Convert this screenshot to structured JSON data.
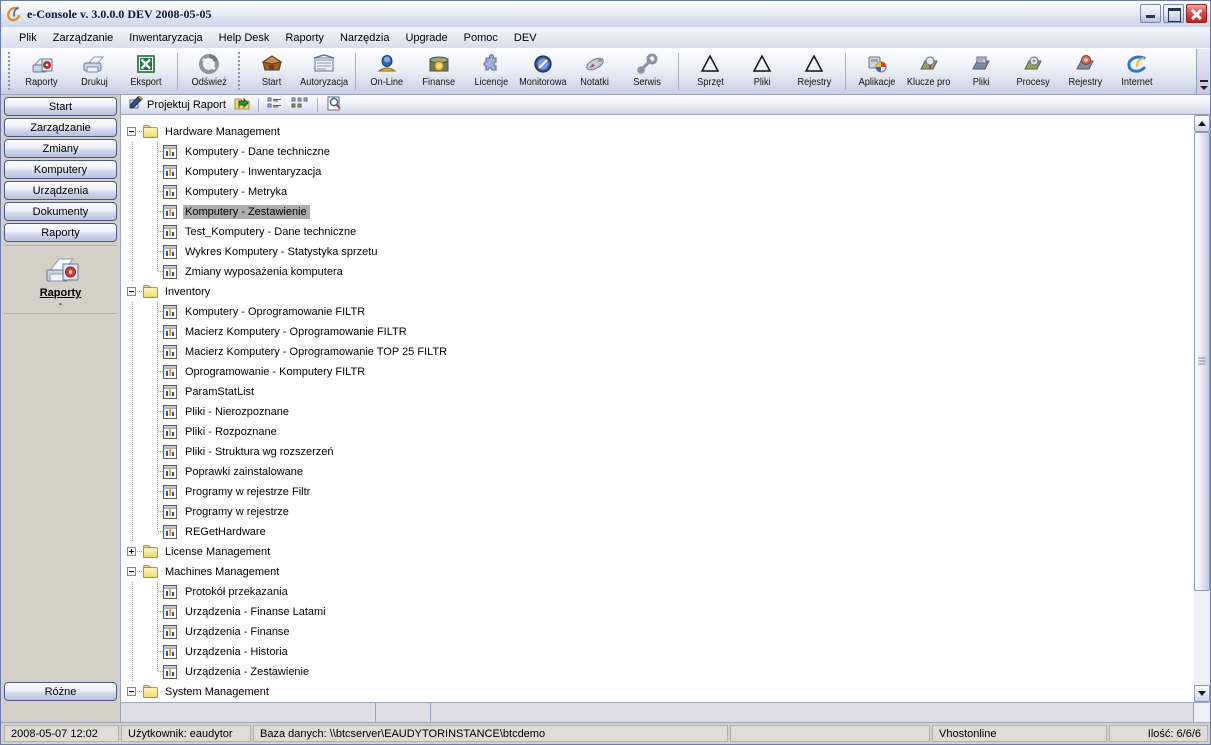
{
  "window": {
    "title": "e-Console v. 3.0.0.0 DEV 2008-05-05",
    "app_icon": "e-console-logo-icon",
    "controls": {
      "minimize": "minimize-button",
      "maximize": "maximize-button",
      "close": "close-button"
    },
    "accent_blue": "#4a5a85",
    "close_red": "#c01f1a",
    "selection_gray": "#adadad"
  },
  "menubar": {
    "items": [
      {
        "label": "Plik"
      },
      {
        "label": "Zarządzanie"
      },
      {
        "label": "Inwentaryzacja"
      },
      {
        "label": "Help Desk"
      },
      {
        "label": "Raporty"
      },
      {
        "label": "Narzędzia"
      },
      {
        "label": "Upgrade"
      },
      {
        "label": "Pomoc"
      },
      {
        "label": "DEV"
      }
    ]
  },
  "toolbar": {
    "groups": [
      {
        "grip": true,
        "buttons": [
          {
            "label": "Raporty",
            "icon": "report-print-icon"
          },
          {
            "label": "Drukuj",
            "icon": "printer-icon"
          },
          {
            "label": "Eksport",
            "icon": "excel-export-icon"
          },
          {
            "separator_before": true,
            "label": "Odśwież",
            "icon": "refresh-icon"
          }
        ]
      },
      {
        "grip": true,
        "buttons": [
          {
            "label": "Start",
            "icon": "home-icon"
          },
          {
            "label": "Autoryzacja",
            "icon": "authorization-icon"
          },
          {
            "separator_before": true,
            "label": "On-Line",
            "icon": "online-user-icon"
          },
          {
            "label": "Finanse",
            "icon": "coins-finance-icon"
          },
          {
            "label": "Licencje",
            "icon": "license-puzzle-icon"
          },
          {
            "label": "Monitorowa",
            "icon": "monitoring-icon"
          },
          {
            "label": "Notatki",
            "icon": "notes-pen-icon"
          },
          {
            "label": "Serwis",
            "icon": "service-wrench-icon"
          },
          {
            "separator_before": true,
            "label": "Sprzęt",
            "icon": "hardware-delta-icon"
          },
          {
            "label": "Pliki",
            "icon": "files-delta-icon"
          },
          {
            "label": "Rejestry",
            "icon": "registry-delta-icon"
          },
          {
            "separator_before": true,
            "label": "Aplikacje",
            "icon": "applications-icon"
          },
          {
            "label": "Klucze pro",
            "icon": "product-keys-icon"
          },
          {
            "label": "Pliki",
            "icon": "files-scan-icon"
          },
          {
            "label": "Procesy",
            "icon": "processes-icon"
          },
          {
            "label": "Rejestry",
            "icon": "registry-scan-icon"
          },
          {
            "label": "Internet",
            "icon": "internet-explorer-icon"
          }
        ]
      }
    ],
    "overflow": "toolbar-overflow-chevron"
  },
  "toolbar2": {
    "design_report": {
      "label": "Projektuj Raport",
      "icon": "design-report-pencil-icon"
    },
    "open_folder": {
      "icon": "open-folder-icon"
    },
    "list_view": {
      "icon": "list-view-icon"
    },
    "detail_view": {
      "icon": "detail-view-icon"
    },
    "preview": {
      "icon": "print-preview-icon"
    }
  },
  "sidebar": {
    "nav_items": [
      {
        "label": "Start"
      },
      {
        "label": "Zarządzanie"
      },
      {
        "label": "Zmiany"
      },
      {
        "label": "Komputery"
      },
      {
        "label": "Urządzenia"
      },
      {
        "label": "Dokumenty"
      },
      {
        "label": "Raporty"
      }
    ],
    "current": {
      "label": "Raporty",
      "sub": "-",
      "icon": "reports-printer-icon"
    },
    "bottom_item": {
      "label": "Różne"
    }
  },
  "tree": {
    "nodes": [
      {
        "level": 0,
        "type": "folder",
        "expanded": true,
        "label": "Hardware Management"
      },
      {
        "level": 1,
        "type": "report",
        "label": "Komputery - Dane techniczne"
      },
      {
        "level": 1,
        "type": "report",
        "label": "Komputery - Inwentaryzacja"
      },
      {
        "level": 1,
        "type": "report",
        "label": "Komputery - Metryka"
      },
      {
        "level": 1,
        "type": "report",
        "label": "Komputery - Zestawienie",
        "selected": true
      },
      {
        "level": 1,
        "type": "report",
        "label": "Test_Komputery - Dane techniczne"
      },
      {
        "level": 1,
        "type": "report",
        "label": "Wykres Komputery - Statystyka sprzetu"
      },
      {
        "level": 1,
        "type": "report",
        "label": "Zmiany wyposażenia komputera",
        "last": true
      },
      {
        "level": 0,
        "type": "folder",
        "expanded": true,
        "label": "Inventory"
      },
      {
        "level": 1,
        "type": "report",
        "label": "Komputery - Oprogramowanie FILTR"
      },
      {
        "level": 1,
        "type": "report",
        "label": "Macierz Komputery - Oprogramowanie FILTR"
      },
      {
        "level": 1,
        "type": "report",
        "label": "Macierz Komputery - Oprogramowanie TOP 25 FILTR"
      },
      {
        "level": 1,
        "type": "report",
        "label": "Oprogramowanie - Komputery FILTR"
      },
      {
        "level": 1,
        "type": "report",
        "label": "ParamStatList"
      },
      {
        "level": 1,
        "type": "report",
        "label": "Pliki - Nierozpoznane"
      },
      {
        "level": 1,
        "type": "report",
        "label": "Pliki - Rozpoznane"
      },
      {
        "level": 1,
        "type": "report",
        "label": "Pliki - Struktura wg rozszerzeń"
      },
      {
        "level": 1,
        "type": "report",
        "label": "Poprawki zainstalowane"
      },
      {
        "level": 1,
        "type": "report",
        "label": "Programy w rejestrze Filtr"
      },
      {
        "level": 1,
        "type": "report",
        "label": "Programy w rejestrze"
      },
      {
        "level": 1,
        "type": "report",
        "label": "REGetHardware",
        "last": true
      },
      {
        "level": 0,
        "type": "folder",
        "expanded": false,
        "label": "License Management"
      },
      {
        "level": 0,
        "type": "folder",
        "expanded": true,
        "label": "Machines Management"
      },
      {
        "level": 1,
        "type": "report",
        "label": "Protokół przekazania"
      },
      {
        "level": 1,
        "type": "report",
        "label": "Urządzenia - Finanse Latami"
      },
      {
        "level": 1,
        "type": "report",
        "label": "Urządzenia - Finanse"
      },
      {
        "level": 1,
        "type": "report",
        "label": "Urządzenia - Historia"
      },
      {
        "level": 1,
        "type": "report",
        "label": "Urządzenia - Zestawienie",
        "last": true
      },
      {
        "level": 0,
        "type": "folder",
        "expanded": true,
        "label": "System Management"
      }
    ]
  },
  "scrollbar": {
    "up": "scroll-up-arrow-icon",
    "down": "scroll-down-arrow-icon",
    "thumb_grip": "scrollbar-thumb-grip"
  },
  "statusbar": {
    "datetime": "2008-05-07  12:02",
    "user": "Użytkownik: eaudytor",
    "database": "Baza danych: \\\\btcserver\\EAUDYTORINSTANCE\\btcdemo",
    "blank": "",
    "host": "Vhostonline",
    "count": "Ilość: 6/6/6"
  }
}
